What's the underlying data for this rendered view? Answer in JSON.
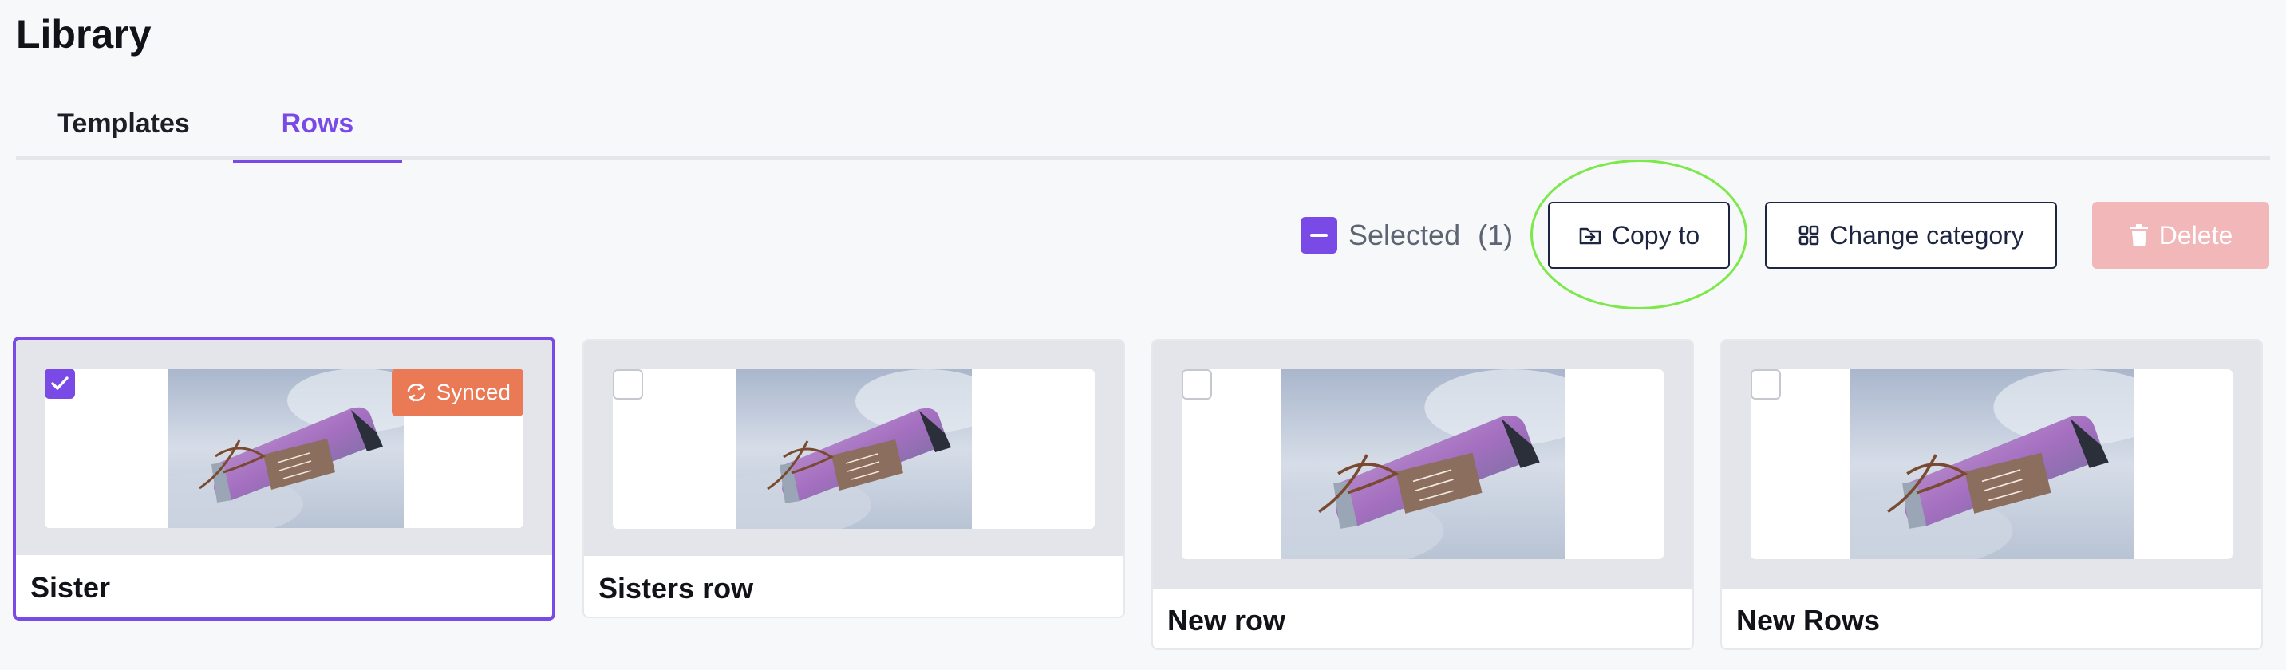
{
  "header": {
    "title": "Library"
  },
  "tabs": [
    {
      "label": "Templates",
      "active": false
    },
    {
      "label": "Rows",
      "active": true
    }
  ],
  "toolbar": {
    "selected_label": "Selected",
    "selected_count": "(1)",
    "copy_label": "Copy to",
    "category_label": "Change category",
    "delete_label": "Delete"
  },
  "cards": [
    {
      "name": "Sister",
      "selected": true,
      "badge": "Synced"
    },
    {
      "name": "Sisters row",
      "selected": false
    },
    {
      "name": "New row",
      "selected": false
    },
    {
      "name": "New Rows",
      "selected": false
    }
  ],
  "colors": {
    "accent": "#7a4ae6",
    "badge": "#ea7a55",
    "delete_disabled": "#f1b7b9",
    "highlight": "#7ce84a"
  },
  "icons": {
    "copy": "folder-arrow-icon",
    "category": "grid-icon",
    "delete": "trash-icon",
    "synced": "sync-icon"
  }
}
